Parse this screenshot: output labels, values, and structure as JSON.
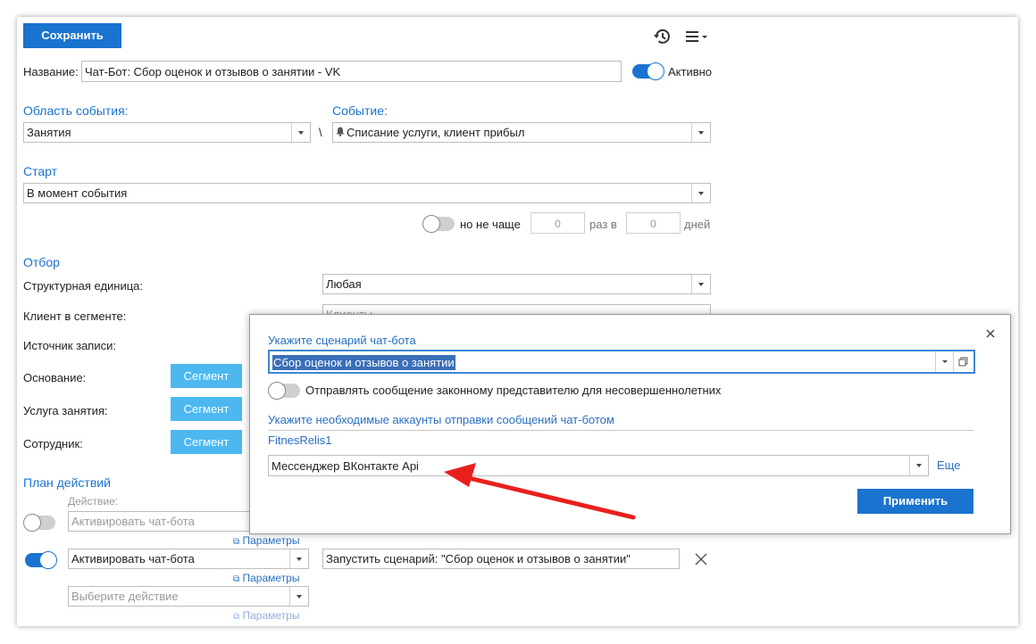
{
  "toolbar": {
    "save_label": "Сохранить",
    "history_icon": "history-icon",
    "menu_icon": "menu-icon"
  },
  "name": {
    "label": "Название:",
    "value": "Чат-Бот: Сбор оценок и отзывов о занятии - VK",
    "active_label": "Активно",
    "active": true
  },
  "event_area": {
    "label": "Область события:",
    "value": "Занятия",
    "separator": "\\"
  },
  "event": {
    "label": "Событие:",
    "value": "Списание услуги, клиент прибыл",
    "icon": "bell-icon"
  },
  "start": {
    "label": "Старт",
    "value": "В момент события",
    "freq_label": "но не чаще",
    "times_value": "0",
    "times_label": "раз в",
    "days_value": "0",
    "days_label": "дней"
  },
  "filter": {
    "label": "Отбор",
    "unit_label": "Структурная единица:",
    "unit_value": "Любая",
    "segment_label": "Клиент в сегменте:",
    "segment_placeholder": "Клиенты",
    "source_label": "Источник записи:",
    "basis_label": "Основание:",
    "service_label": "Услуга занятия:",
    "employee_label": "Сотрудник:",
    "segment_button": "Сегмент"
  },
  "plan": {
    "label": "План действий",
    "action_label": "Действие:",
    "row1_value": "Активировать чат-бота",
    "params_label": "Параметры",
    "row2_value": "Активировать чат-бота",
    "row2_scenario": "Запустить сценарий: \"Сбор оценок и отзывов о занятии\"",
    "row3_placeholder": "Выберите действие"
  },
  "modal": {
    "scenario_label": "Укажите сценарий чат-бота",
    "scenario_value": "Сбор оценок и отзывов о занятии",
    "guardian_label": "Отправлять сообщение законному представителю для несовершеннолетних",
    "accounts_label": "Укажите необходимые аккаунты отправки сообщений чат-ботом",
    "account_name": "FitnesRelis1",
    "messenger_value": "Мессенджер ВКонтакте Api",
    "more_label": "Еще",
    "apply_label": "Применить",
    "close_icon": "close-icon"
  },
  "colors": {
    "accent": "#1a73cf",
    "segment_button": "#4db8f0",
    "arrow": "#e8201c"
  }
}
